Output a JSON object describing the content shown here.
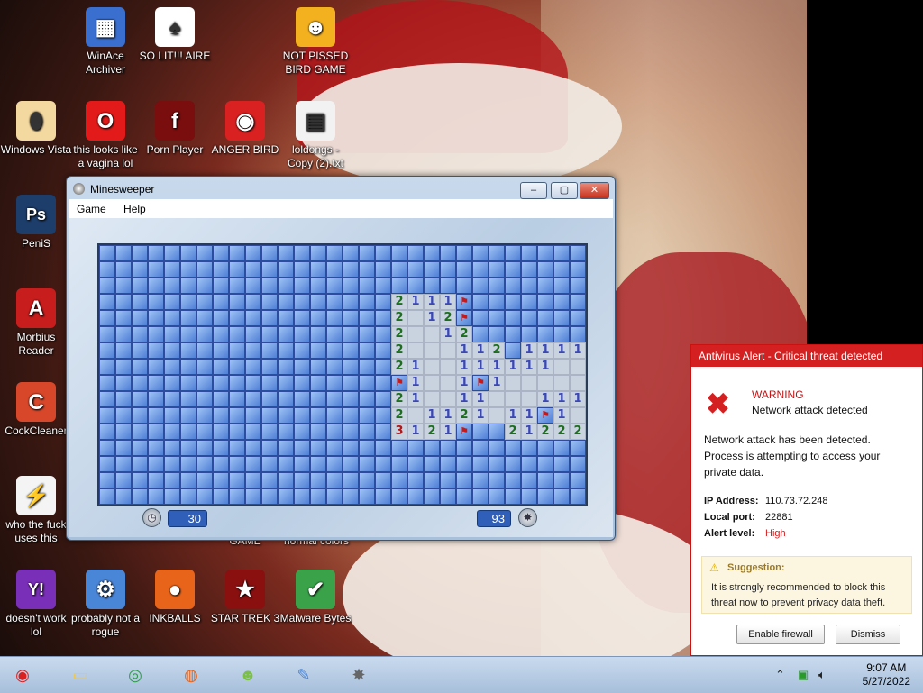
{
  "desktop_icons": [
    {
      "label": "WinAce Archiver",
      "icon": "winace-icon",
      "glyph": "▦",
      "color": "#3a6fd0"
    },
    {
      "label": "SO LIT!!! AIRE",
      "icon": "solitaire-icon",
      "glyph": "♠",
      "color": "#ffffff"
    },
    {
      "label": "NOT PISSED BIRD GAME",
      "icon": "bad-piggies-icon",
      "glyph": "☻",
      "color": "#f3b120"
    },
    {
      "label": "Windows Vista",
      "icon": "egg-icon",
      "glyph": "⬮",
      "color": "#f3d8a0"
    },
    {
      "label": "this looks like a vagina lol",
      "icon": "opera-icon",
      "glyph": "O",
      "color": "#e21a1a"
    },
    {
      "label": "Porn Player",
      "icon": "flash-player-icon",
      "glyph": "f",
      "color": "#7a0d0d"
    },
    {
      "label": "ANGER BIRD",
      "icon": "angry-birds-icon",
      "glyph": "◉",
      "color": "#d92121"
    },
    {
      "label": "loldongs - Copy (2).txt",
      "icon": "text-file-icon",
      "glyph": "▤",
      "color": "#f2f2f2"
    },
    {
      "label": "PeniS",
      "icon": "photoshop-icon",
      "glyph": "Ps",
      "color": "#1d3d6a"
    },
    {
      "label": "Morbius Reader",
      "icon": "acrobat-reader-icon",
      "glyph": "A",
      "color": "#c81d1d"
    },
    {
      "label": "CockCleaner",
      "icon": "ccleaner-icon",
      "glyph": "C",
      "color": "#d9472a"
    },
    {
      "label": "who the fuck uses this",
      "icon": "flash-icon",
      "glyph": "⚡",
      "color": "#f4f4f4"
    },
    {
      "label": "doesn't work lol",
      "icon": "yahoo-messenger-icon",
      "glyph": "Y!",
      "color": "#7a2fb8"
    },
    {
      "label": "probably not a rogue",
      "icon": "control-panel-icon",
      "glyph": "⚙",
      "color": "#4a86d8"
    },
    {
      "label": "INKBALLS",
      "icon": "inkball-icon",
      "glyph": "●",
      "color": "#e8641a"
    },
    {
      "label": "STAR TREK 3",
      "icon": "star-wars-icon",
      "glyph": "★",
      "color": "#8a1010"
    },
    {
      "label": "Malware Bytes",
      "icon": "shield-check-icon",
      "glyph": "✔",
      "color": "#3aa34a"
    }
  ],
  "partial_labels": {
    "game": "GAME",
    "normal_colors": "normal colors"
  },
  "minesweeper": {
    "title": "Minesweeper",
    "menu": [
      "Game",
      "Help"
    ],
    "time": "30",
    "mines_left": "93",
    "rows": [
      "..............................",
      "..............................",
      "..............................",
      "..................2111F.......",
      "..................2 12F.......",
      "..................2  12.......",
      "..................2   112.11111",
      "..................21  111111   1111",
      "..................F1  1F1      1",
      "..................21  11   111   11",
      "..................2 1121 11F1    ",
      "..................3121F..2122221 11",
      "..............................",
      "..............................",
      "..............................",
      ".............................."
    ]
  },
  "alert": {
    "title": "Antivirus Alert - Critical threat detected",
    "warning": "WARNING",
    "subtitle": "Network attack detected",
    "body": "Network attack has been detected. Process is attempting to access your private data.",
    "ip_label": "IP Address:",
    "ip_value": "110.73.72.248",
    "port_label": "Local port:",
    "port_value": "22881",
    "level_label": "Alert level:",
    "level_value": "High",
    "suggestion_title": "Suggestion:",
    "suggestion_text": "It is strongly recommended to block this threat now to prevent privacy data theft.",
    "enable_btn": "Enable firewall",
    "dismiss_btn": "Dismiss"
  },
  "taskbar": {
    "apps": [
      {
        "icon": "angry-bird-start-icon",
        "glyph": "◉"
      },
      {
        "icon": "file-explorer-icon",
        "glyph": "▭"
      },
      {
        "icon": "chrome-icon",
        "glyph": "◎"
      },
      {
        "icon": "firefox-icon",
        "glyph": "◍"
      },
      {
        "icon": "bad-piggies-taskbar-icon",
        "glyph": "☻"
      },
      {
        "icon": "paint-icon",
        "glyph": "✎"
      },
      {
        "icon": "minesweeper-taskbar-icon",
        "glyph": "✸"
      }
    ],
    "time": "9:07 AM",
    "date": "5/27/2022"
  }
}
